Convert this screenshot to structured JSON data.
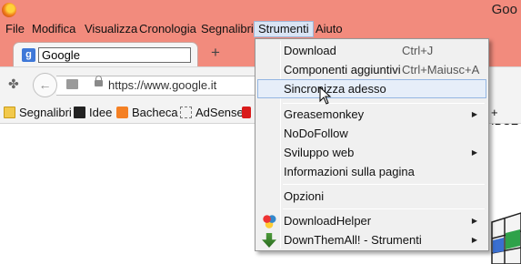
{
  "window": {
    "title": "Goo"
  },
  "menubar": {
    "items": [
      {
        "label": "File"
      },
      {
        "label": "Modifica"
      },
      {
        "label": "Visualizza"
      },
      {
        "label": "Cronologia"
      },
      {
        "label": "Segnalibri"
      },
      {
        "label": "Strumenti",
        "active": true
      },
      {
        "label": "Aiuto"
      }
    ]
  },
  "tab": {
    "title": "Google",
    "new_tab_symbol": "+"
  },
  "navbar": {
    "url": "https://www.google.it"
  },
  "bookmarks": {
    "items": [
      {
        "label": "Segnalibri",
        "icon": "folder-icon"
      },
      {
        "label": "Idee",
        "icon": "monitor-icon"
      },
      {
        "label": "Bacheca",
        "icon": "blogger-icon"
      },
      {
        "label": "AdSense",
        "icon": "dashed-box-icon"
      },
      {
        "label": "+ IPCE",
        "icon": ""
      }
    ]
  },
  "dropdown": {
    "items": [
      {
        "label": "Download",
        "shortcut": "Ctrl+J"
      },
      {
        "label": "Componenti aggiuntivi",
        "shortcut": "Ctrl+Maiusc+A"
      },
      {
        "label": "Sincronizza adesso",
        "highlighted": true
      },
      {
        "label": "Greasemonkey",
        "submenu": true
      },
      {
        "label": "NoDoFollow"
      },
      {
        "label": "Sviluppo web",
        "submenu": true
      },
      {
        "label": "Informazioni sulla pagina"
      },
      {
        "label": "Opzioni"
      },
      {
        "label": "DownloadHelper",
        "submenu": true,
        "icon": "downloadhelper-icon"
      },
      {
        "label": "DownThemAll! - Strumenti",
        "submenu": true,
        "icon": "downthemall-icon"
      }
    ]
  },
  "colors": {
    "chrome_accent": "#f28b7d",
    "menu_highlight": "#e6eef9",
    "favicon": "#3f78d8"
  }
}
